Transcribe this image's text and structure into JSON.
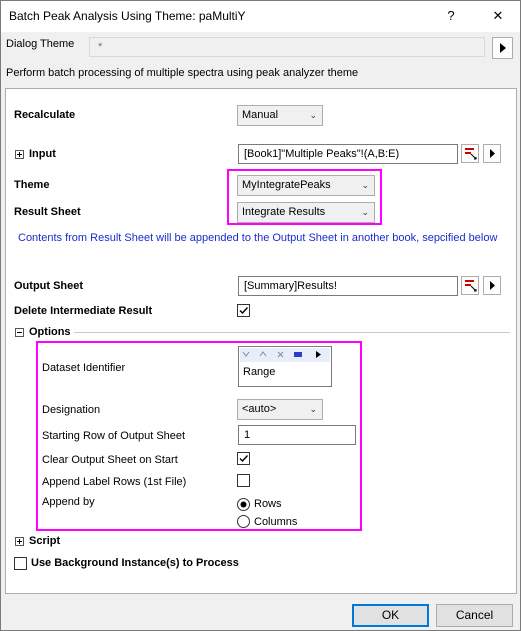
{
  "window": {
    "title": "Batch Peak Analysis Using Theme: paMultiY",
    "help_glyph": "?",
    "close_glyph": "✕"
  },
  "dialog_theme": {
    "label": "Dialog Theme",
    "value": "*"
  },
  "description": "Perform batch processing of multiple spectra using peak analyzer theme",
  "form": {
    "recalculate": {
      "label": "Recalculate",
      "value": "Manual"
    },
    "input": {
      "label": "Input",
      "value": "[Book1]\"Multiple Peaks\"!(A,B:E)"
    },
    "theme": {
      "label": "Theme",
      "value": "MyIntegratePeaks"
    },
    "result_sheet": {
      "label": "Result Sheet",
      "value": "Integrate Results"
    },
    "note": "Contents from Result Sheet will be appended to the Output Sheet in another book, sepcified below",
    "output_sheet": {
      "label": "Output Sheet",
      "value": "[Summary]Results!"
    },
    "delete_intermediate": {
      "label": "Delete Intermediate Result",
      "checked": true
    },
    "options": {
      "label": "Options",
      "dataset_identifier": {
        "label": "Dataset Identifier",
        "value": "Range"
      },
      "designation": {
        "label": "Designation",
        "value": "<auto>"
      },
      "starting_row": {
        "label": "Starting Row of Output Sheet",
        "value": "1"
      },
      "clear_output": {
        "label": "Clear Output Sheet on Start",
        "checked": true
      },
      "append_label": {
        "label": "Append Label Rows (1st File)",
        "checked": false
      },
      "append_by": {
        "label": "Append by",
        "options": [
          "Rows",
          "Columns"
        ],
        "selected": "Rows"
      }
    },
    "script": {
      "label": "Script"
    },
    "background": {
      "label": "Use Background Instance(s) to Process",
      "checked": false
    }
  },
  "buttons": {
    "ok": "OK",
    "cancel": "Cancel"
  },
  "colors": {
    "highlight": "#ff00ff",
    "note": "#1a2ccc",
    "accent": "#0078d7"
  }
}
